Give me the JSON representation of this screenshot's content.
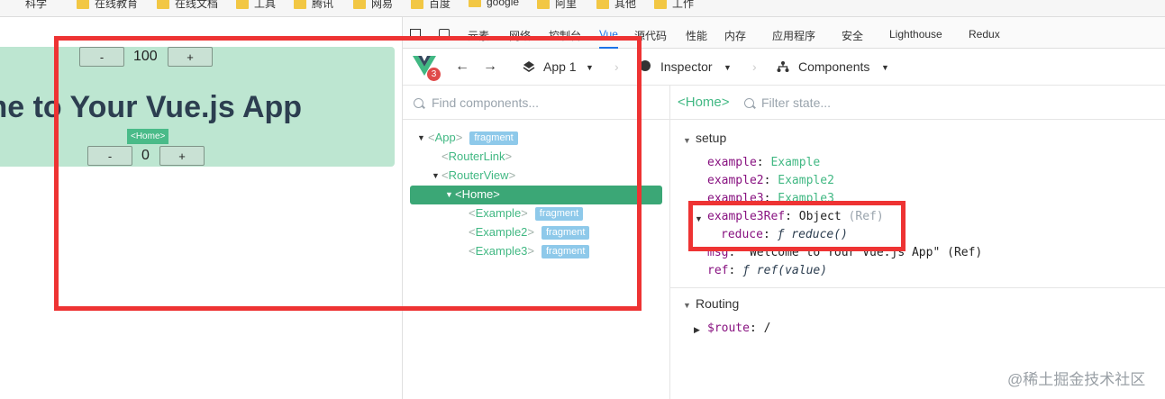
{
  "bookmarks": [
    "科学",
    "在线教育",
    "在线文档",
    "工具",
    "腾讯",
    "网易",
    "百度",
    "google",
    "阿里",
    "其他",
    "工作"
  ],
  "app": {
    "counter1_minus": "-",
    "counter1_value": "100",
    "counter1_plus": "+",
    "heading": "me to Your Vue.js App",
    "home_tag": "<Home>",
    "counter2_minus": "-",
    "counter2_value": "0",
    "counter2_plus": "+"
  },
  "devtools_tabs": [
    "元素",
    "网络",
    "控制台",
    "Vue",
    "源代码",
    "性能",
    "内存",
    "应用程序",
    "安全",
    "Lighthouse",
    "Redux"
  ],
  "vue_toolbar": {
    "badge": "3",
    "app_selector": "App 1",
    "inspector": "Inspector",
    "components": "Components"
  },
  "tree": {
    "search_placeholder": "Find components...",
    "nodes": [
      {
        "name": "App",
        "fragment": "fragment"
      },
      {
        "name": "RouterLink"
      },
      {
        "name": "RouterView"
      },
      {
        "name": "Home"
      },
      {
        "name": "Example",
        "fragment": "fragment"
      },
      {
        "name": "Example2",
        "fragment": "fragment"
      },
      {
        "name": "Example3",
        "fragment": "fragment"
      }
    ]
  },
  "state": {
    "component": "<Home>",
    "filter_placeholder": "Filter state...",
    "setup_title": "setup",
    "props": [
      {
        "key": "example",
        "value": "Example"
      },
      {
        "key": "example2",
        "value": "Example2"
      },
      {
        "key": "example3",
        "value": "Example3"
      },
      {
        "key": "example3Ref",
        "value": "Object",
        "tag": "(Ref)"
      },
      {
        "key": "reduce",
        "value": "ƒ reduce()"
      },
      {
        "key": "msg",
        "value": "\"Welcome to Your Vue.js App\"",
        "tag": "(Ref)"
      },
      {
        "key": "ref",
        "value": "ƒ ref(value)"
      }
    ],
    "routing_title": "Routing",
    "route_key": "$route",
    "route_value": "/"
  },
  "watermark": "@稀土掘金技术社区",
  "colors": {
    "vue_green": "#41b883",
    "selected_row": "#3ba776",
    "annotation_red": "#ee3333",
    "fragment_badge": "#8ec9ea"
  }
}
